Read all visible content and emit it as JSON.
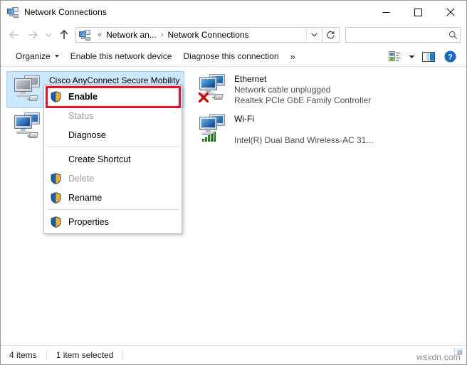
{
  "window": {
    "title": "Network Connections",
    "icon": "network-connections-icon",
    "controls": {
      "minimize": "minimize-button",
      "maximize": "maximize-button",
      "close": "close-button"
    }
  },
  "nav": {
    "back": "back-arrow",
    "forward": "forward-arrow",
    "recent": "recent-locations-chevron",
    "up": "up-arrow",
    "refresh": "refresh-icon",
    "breadcrumb": {
      "icon": "network-connections-icon",
      "overflow": "«",
      "items": [
        "Network an...",
        "Network Connections"
      ],
      "separator": "›"
    },
    "dropdown": "chevron-down-icon"
  },
  "search": {
    "value": "",
    "placeholder": "",
    "icon": "search-icon"
  },
  "toolbar": {
    "organize_label": "Organize",
    "enable_device_label": "Enable this network device",
    "diagnose_label": "Diagnose this connection",
    "overflow_label": "»",
    "view_icon": "view-options-icon",
    "view_caret": "chevron-down-icon",
    "preview_pane_icon": "preview-pane-icon",
    "help_icon": "help-icon"
  },
  "connections": [
    {
      "name": "Cisco AnyConnect Secure Mobility",
      "status": "",
      "adapter": "",
      "icon": "network-adapter-disabled-icon",
      "badge": "cable-icon",
      "selected": true
    },
    {
      "name": "",
      "status": "",
      "adapter": "",
      "icon": "network-adapter-icon",
      "badge": "cable-icon",
      "selected": false
    },
    {
      "name": "Ethernet",
      "status": "Network cable unplugged",
      "adapter": "Realtek PCIe GbE Family Controller",
      "icon": "network-adapter-icon",
      "badge": "red-x-icon",
      "selected": false
    },
    {
      "name": "Wi-Fi",
      "status": "",
      "adapter": "Intel(R) Dual Band Wireless-AC 31...",
      "icon": "network-adapter-icon",
      "badge": "wifi-signal-icon",
      "selected": false
    }
  ],
  "context_menu": {
    "items": [
      {
        "label": "Enable",
        "shield": true,
        "disabled": false,
        "bold": true,
        "separator_after": false
      },
      {
        "label": "Status",
        "shield": false,
        "disabled": true,
        "bold": false,
        "separator_after": false
      },
      {
        "label": "Diagnose",
        "shield": false,
        "disabled": false,
        "bold": false,
        "separator_after": true
      },
      {
        "label": "Create Shortcut",
        "shield": false,
        "disabled": false,
        "bold": false,
        "separator_after": false
      },
      {
        "label": "Delete",
        "shield": true,
        "disabled": true,
        "bold": false,
        "separator_after": false
      },
      {
        "label": "Rename",
        "shield": true,
        "disabled": false,
        "bold": false,
        "separator_after": true
      },
      {
        "label": "Properties",
        "shield": true,
        "disabled": false,
        "bold": false,
        "separator_after": false
      }
    ],
    "highlight_color": "#e8112d",
    "highlighted_item": "Enable"
  },
  "statusbar": {
    "item_count": "4 items",
    "selection": "1 item selected"
  },
  "watermark": {
    "text": "wsxdn.com"
  },
  "colors": {
    "selection_fill": "#cce8ff",
    "selection_border": "#99d1ff",
    "accent_red": "#e8112d",
    "help_blue": "#1569c7",
    "signal_green": "#1f8a14"
  }
}
